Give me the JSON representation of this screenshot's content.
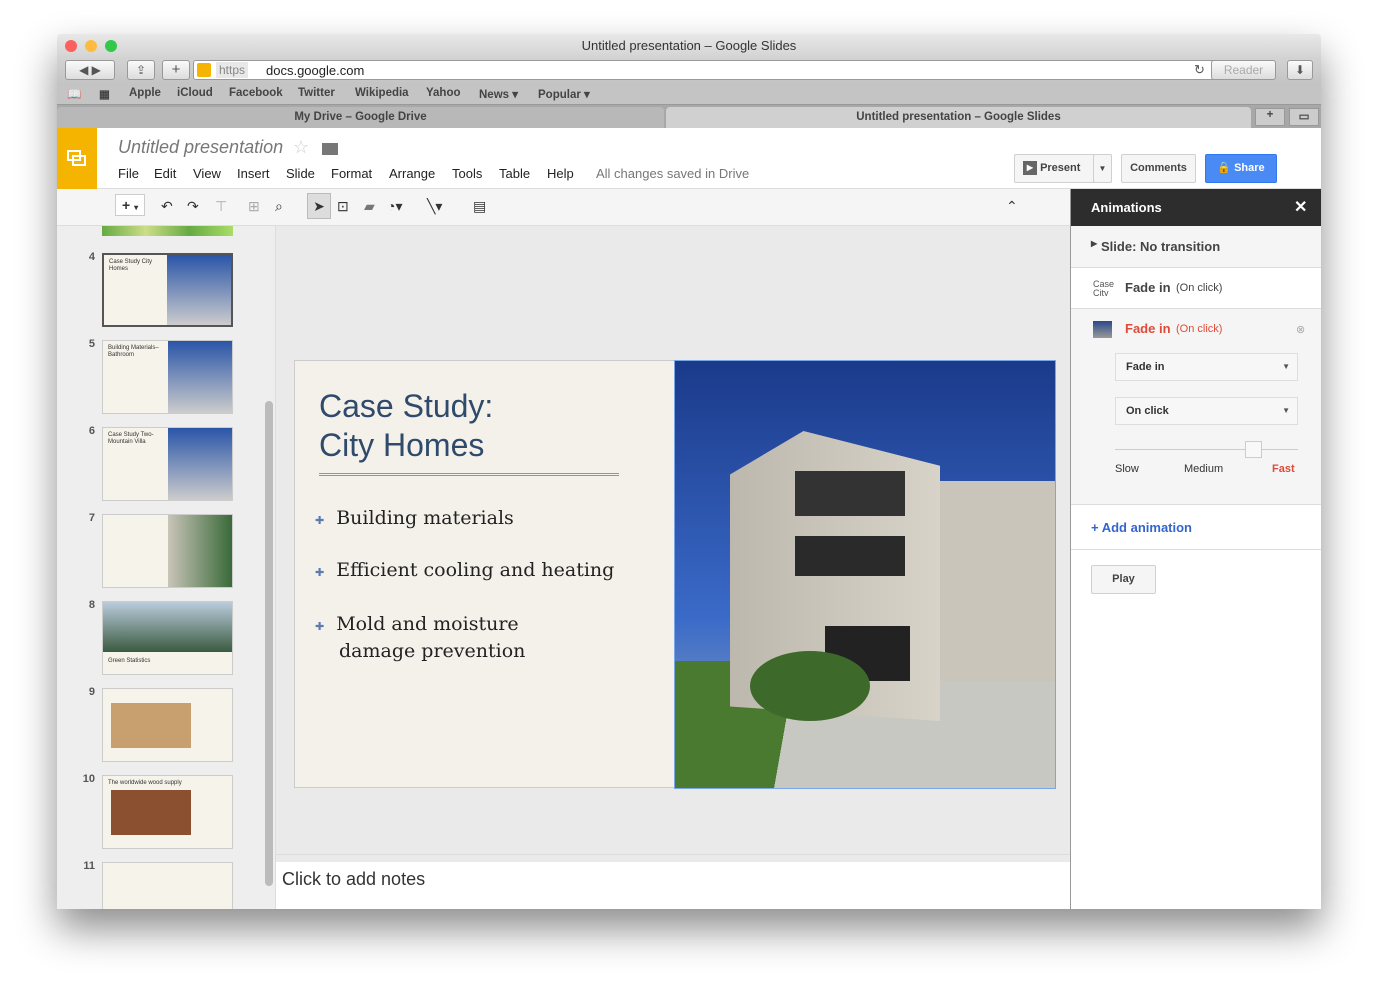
{
  "window_title": "Untitled presentation – Google Slides",
  "browser": {
    "https": "https",
    "url": "docs.google.com",
    "reader": "Reader",
    "bookmarks": [
      "Apple",
      "iCloud",
      "Facebook",
      "Twitter",
      "Wikipedia",
      "Yahoo",
      "News ▾",
      "Popular ▾"
    ],
    "tabs": [
      "My Drive – Google Drive",
      "Untitled presentation – Google Slides"
    ]
  },
  "app": {
    "title": "Untitled presentation",
    "menu": [
      "File",
      "Edit",
      "View",
      "Insert",
      "Slide",
      "Format",
      "Arrange",
      "Tools",
      "Table",
      "Help"
    ],
    "save_status": "All changes saved in Drive",
    "present": "Present",
    "comments": "Comments",
    "share": "Share"
  },
  "filmstrip": [
    {
      "n": "4",
      "title": "Case Study City Homes"
    },
    {
      "n": "5",
      "title": "Building Materials–Bathroom"
    },
    {
      "n": "6",
      "title": "Case Study Two-Mountain Villa"
    },
    {
      "n": "7",
      "title": ""
    },
    {
      "n": "8",
      "title": "Green Statistics"
    },
    {
      "n": "9",
      "title": ""
    },
    {
      "n": "10",
      "title": "The worldwide wood supply"
    },
    {
      "n": "11",
      "title": ""
    }
  ],
  "slide": {
    "title_line1": "Case Study:",
    "title_line2": "City Homes",
    "bullets": [
      "Building materials",
      "Efficient cooling and heating",
      "Mold and moisture",
      "damage prevention"
    ]
  },
  "notes_placeholder": "Click to add notes",
  "animations": {
    "header": "Animations",
    "transition": "Slide: No transition",
    "items": [
      {
        "thumb": "Case City H",
        "effect": "Fade in",
        "trigger": "(On click)"
      },
      {
        "effect": "Fade in",
        "trigger": "(On click)"
      }
    ],
    "effect_select": "Fade in",
    "trigger_select": "On click",
    "speed": {
      "labels": [
        "Slow",
        "Medium",
        "Fast"
      ],
      "value": "Fast"
    },
    "add": "+ Add animation",
    "play": "Play"
  },
  "colors": {
    "accent": "#f4b400",
    "share": "#4a8af4",
    "active": "#dd4b39",
    "title": "#2f4a6b"
  }
}
